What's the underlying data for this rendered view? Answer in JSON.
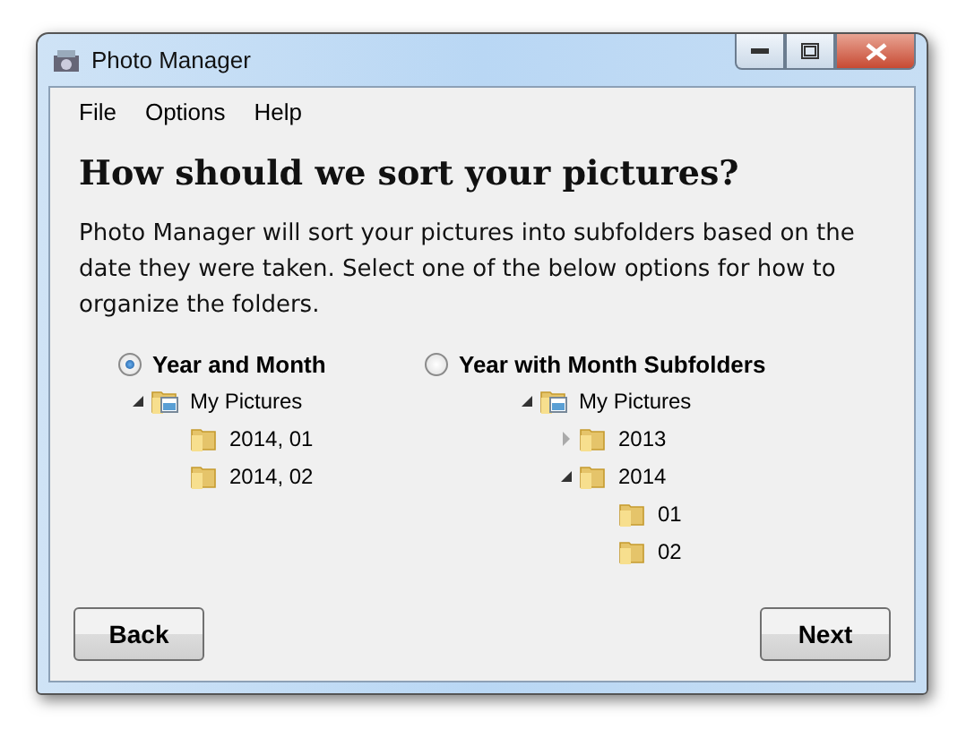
{
  "window": {
    "title": "Photo Manager"
  },
  "menu": [
    "File",
    "Options",
    "Help"
  ],
  "heading": "How should we sort your pictures?",
  "description": "Photo Manager will sort your pictures into subfolders based on the date they were taken.  Select one of the below options for how to organize the folders.",
  "options": [
    {
      "label": "Year and Month",
      "selected": true,
      "tree": [
        {
          "label": "My Pictures",
          "kind": "library",
          "expanded": true,
          "children": [
            {
              "label": "2014, 01",
              "kind": "folder"
            },
            {
              "label": "2014, 02",
              "kind": "folder"
            }
          ]
        }
      ]
    },
    {
      "label": "Year with Month Subfolders",
      "selected": false,
      "tree": [
        {
          "label": "My Pictures",
          "kind": "library",
          "expanded": true,
          "children": [
            {
              "label": "2013",
              "kind": "folder",
              "expanded": false
            },
            {
              "label": "2014",
              "kind": "folder",
              "expanded": true,
              "children": [
                {
                  "label": "01",
                  "kind": "folder"
                },
                {
                  "label": "02",
                  "kind": "folder"
                }
              ]
            }
          ]
        }
      ]
    }
  ],
  "buttons": [
    "Back",
    "Next"
  ]
}
